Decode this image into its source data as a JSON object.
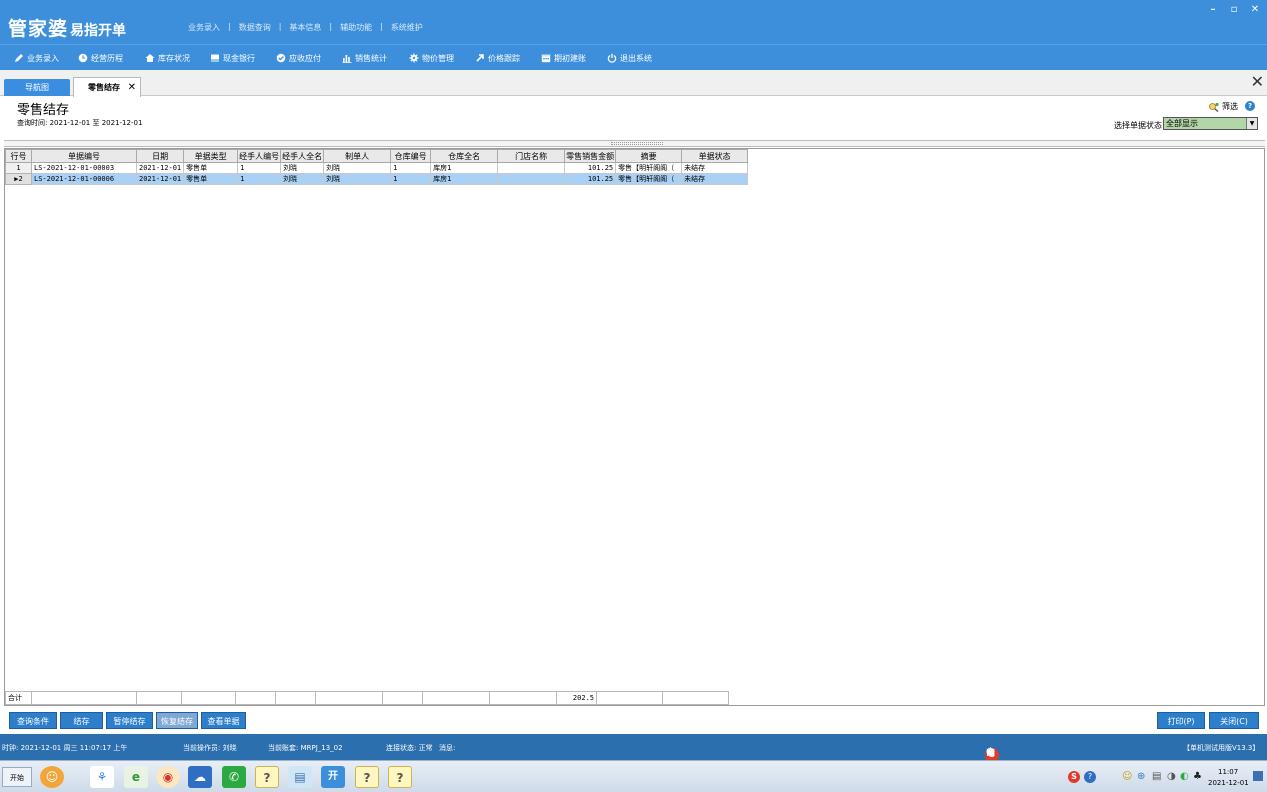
{
  "app": {
    "logo_main": "管家婆",
    "logo_sub": "易指开单",
    "top_menu": [
      "业务录入",
      "数据查询",
      "基本信息",
      "辅助功能",
      "系统维护"
    ],
    "window_controls": [
      "–",
      "▫",
      "✕"
    ]
  },
  "toolbar": {
    "items": [
      {
        "label": "业务录入",
        "icon": "pen-icon"
      },
      {
        "label": "经营历程",
        "icon": "clock-icon"
      },
      {
        "label": "库存状况",
        "icon": "house-icon"
      },
      {
        "label": "现金银行",
        "icon": "book-icon"
      },
      {
        "label": "应收应付",
        "icon": "check-circle-icon"
      },
      {
        "label": "销售统计",
        "icon": "bar-chart-icon"
      },
      {
        "label": "物价管理",
        "icon": "gear-icon"
      },
      {
        "label": "价格跟踪",
        "icon": "arrow-up-right-icon"
      },
      {
        "label": "期初建账",
        "icon": "calendar-icon"
      },
      {
        "label": "退出系统",
        "icon": "power-icon"
      }
    ]
  },
  "tabs": {
    "nav_label": "导航图",
    "active_label": "零售结存",
    "active_close": "✕",
    "close_all": "✕"
  },
  "page": {
    "title": "零售结存",
    "query_time": "查询时间: 2021-12-01 至 2021-12-01",
    "filter_label": "筛选",
    "help": "?",
    "status_label": "选择单据状态",
    "status_value": "全部显示"
  },
  "grid": {
    "columns": [
      "行号",
      "单据编号",
      "日期",
      "单据类型",
      "经手人编号",
      "经手人全名",
      "制单人",
      "仓库编号",
      "仓库全名",
      "门店名称",
      "零售销售金额",
      "摘要",
      "单据状态"
    ],
    "rows": [
      {
        "row_no": "1",
        "marker": "",
        "doc_no": "LS-2021-12-01-00003",
        "date": "2021-12-01",
        "doc_type": "零售单",
        "handler_no": "1",
        "handler_name": "刘晓",
        "maker": "刘晓",
        "wh_no": "1",
        "wh_name": "库房1",
        "store": "",
        "amount": "101.25",
        "summary": "零售【明轩阁阁（",
        "status": "未结存"
      },
      {
        "row_no": "2",
        "marker": "▶",
        "doc_no": "LS-2021-12-01-00006",
        "date": "2021-12-01",
        "doc_type": "零售单",
        "handler_no": "1",
        "handler_name": "刘晓",
        "maker": "刘晓",
        "wh_no": "1",
        "wh_name": "库房1",
        "store": "",
        "amount": "101.25",
        "summary": "零售【明轩阁阁（",
        "status": "未结存"
      }
    ],
    "total_label": "合计",
    "total_amount": "202.5"
  },
  "actions": {
    "query": "查询条件",
    "settle": "结存",
    "pause": "暂停结存",
    "resume": "恢复结存",
    "view": "查看单据",
    "print": "打印(P)",
    "close": "关闭(C)"
  },
  "statusbar": {
    "clock": "时钟: 2021-12-01 周三 11:07:17 上午",
    "operator": "当前操作员: 刘晓",
    "account": "当前账套: MRPJ_13_02",
    "connection": "连接状态: 正常",
    "message": "消息:",
    "version": "【单机测试用版V13.3】",
    "ime_items": [
      "S",
      "中",
      "°,",
      "☺",
      "♪",
      "▦",
      "♙",
      "♚",
      "▣"
    ]
  },
  "taskbar": {
    "start": "开始",
    "apps": [
      "☺",
      "⚘",
      "e",
      "◉",
      "☁",
      "✆",
      "?",
      "▤",
      "开",
      "?",
      "?"
    ],
    "tray": [
      "S",
      "?",
      "☺",
      "⊕",
      "▤",
      "◑",
      "◐",
      "♣"
    ],
    "time": "11:07",
    "date": "2021-12-01"
  },
  "colors": {
    "brand_blue": "#3d8fdc",
    "button_blue": "#2e7fcb",
    "status_bar": "#2c6fae",
    "selected_row": "#a9d1f5",
    "select_field": "#b2d6a8"
  }
}
